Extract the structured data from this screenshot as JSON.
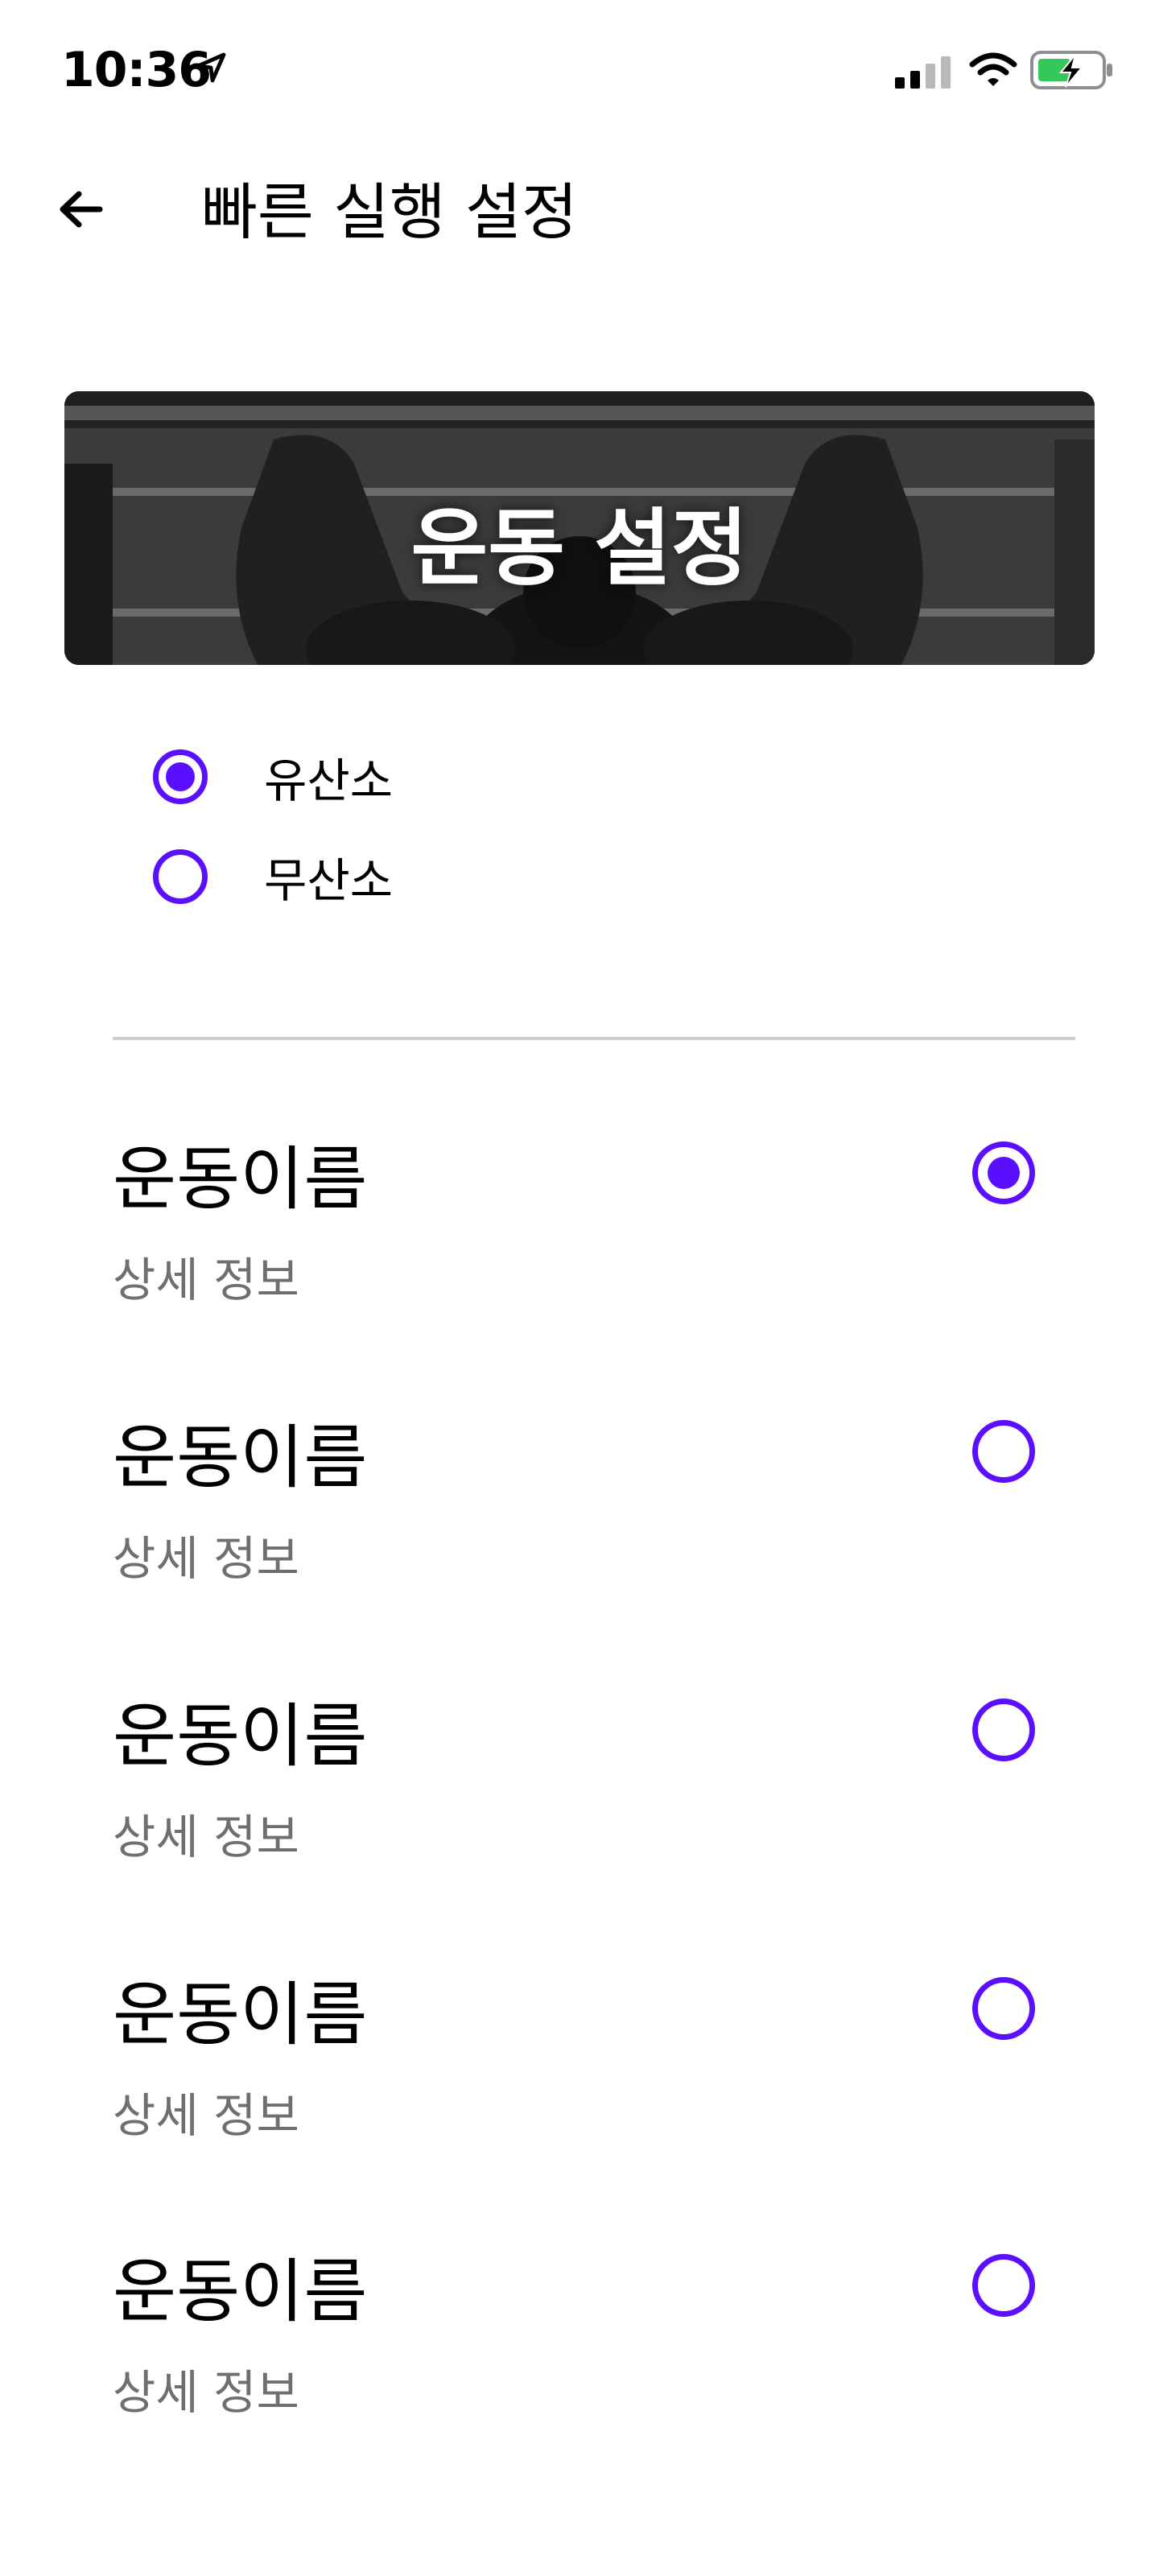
{
  "status_bar": {
    "time": "10:36"
  },
  "header": {
    "title": "빠른 실행 설정"
  },
  "banner": {
    "title": "운동 설정"
  },
  "gas_options": [
    {
      "label": "유산소",
      "selected": true
    },
    {
      "label": "무산소",
      "selected": false
    }
  ],
  "exercises": [
    {
      "name": "운동이름",
      "detail": "상세 정보",
      "selected": true
    },
    {
      "name": "운동이름",
      "detail": "상세 정보",
      "selected": false
    },
    {
      "name": "운동이름",
      "detail": "상세 정보",
      "selected": false
    },
    {
      "name": "운동이름",
      "detail": "상세 정보",
      "selected": false
    },
    {
      "name": "운동이름",
      "detail": "상세 정보",
      "selected": false
    }
  ],
  "colors": {
    "accent": "#5b0fff",
    "battery_green": "#34c759",
    "muted_text": "#6f6f6f",
    "divider": "#cfcfcf"
  }
}
